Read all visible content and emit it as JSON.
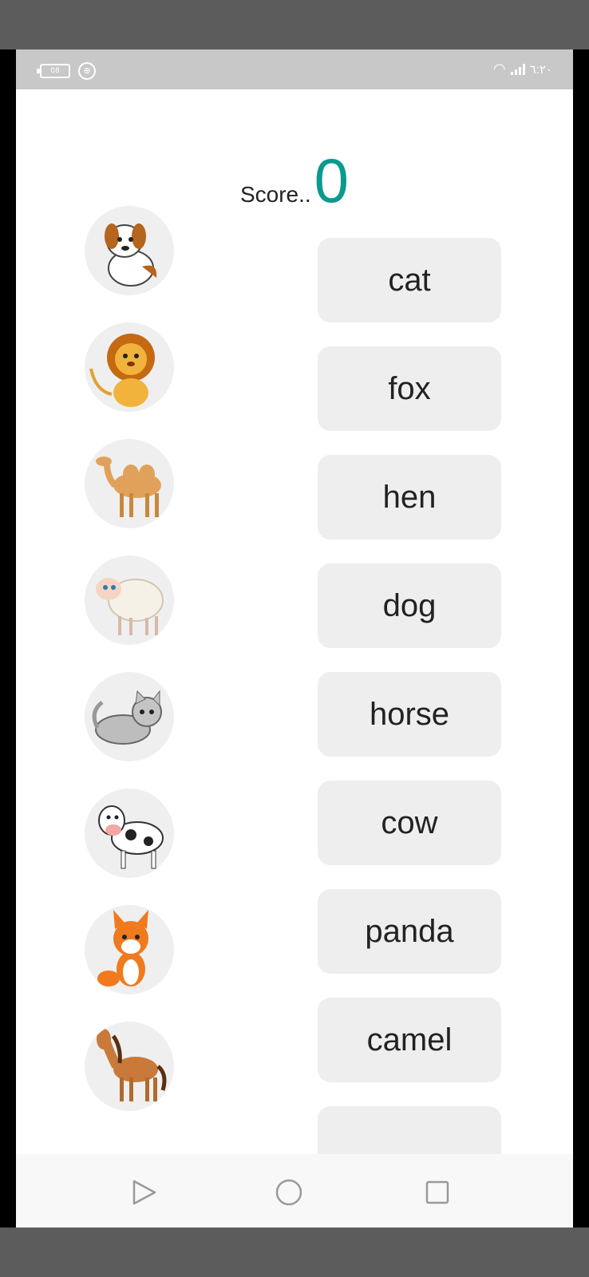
{
  "status_bar": {
    "battery_text": "08",
    "time": "٦:٢٠",
    "icons": [
      "battery-icon",
      "lock-icon",
      "wifi-icon",
      "signal-icon"
    ]
  },
  "score": {
    "label": "Score..",
    "value": "0",
    "value_color": "#0a9a8f"
  },
  "animals": [
    {
      "name": "dog-image"
    },
    {
      "name": "lion-image"
    },
    {
      "name": "camel-image"
    },
    {
      "name": "sheep-image"
    },
    {
      "name": "cat-image"
    },
    {
      "name": "cow-image"
    },
    {
      "name": "fox-image"
    },
    {
      "name": "horse-image"
    }
  ],
  "words": [
    "cat",
    "fox",
    "hen",
    "dog",
    "horse",
    "cow",
    "panda",
    "camel",
    ""
  ],
  "nav": {
    "icons": [
      "back-triangle-icon",
      "home-circle-icon",
      "recents-square-icon"
    ]
  }
}
